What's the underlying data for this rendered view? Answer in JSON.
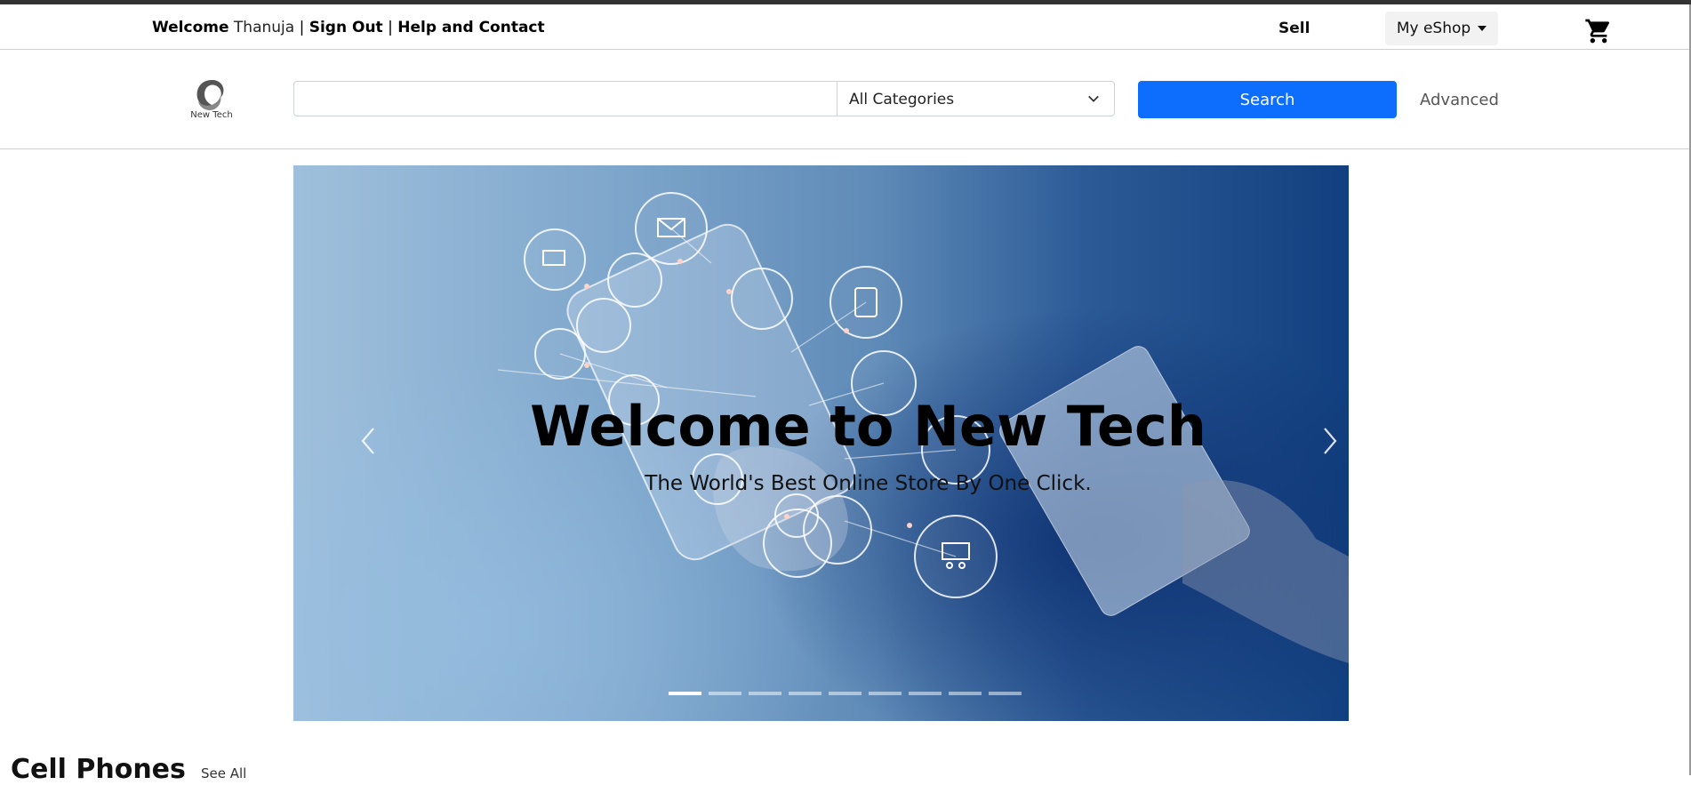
{
  "topbar": {
    "welcome_label": "Welcome",
    "username": "Thanuja",
    "separator": "|",
    "sign_out": "Sign Out",
    "help": "Help and Contact",
    "sell": "Sell",
    "my_eshop": "My eShop"
  },
  "brand": {
    "logo_text": "New Tech"
  },
  "search": {
    "query": "",
    "category": "All Categories",
    "button": "Search",
    "advanced": "Advanced"
  },
  "hero": {
    "title": "Welcome to New Tech",
    "subtitle": "The World's Best Online Store By One Click.",
    "slide_count": 9,
    "active_slide": 1
  },
  "section": {
    "title": "Cell Phones",
    "see_all": "See All"
  },
  "colors": {
    "primary": "#0d6efd",
    "hero_dark": "#123f7f"
  }
}
